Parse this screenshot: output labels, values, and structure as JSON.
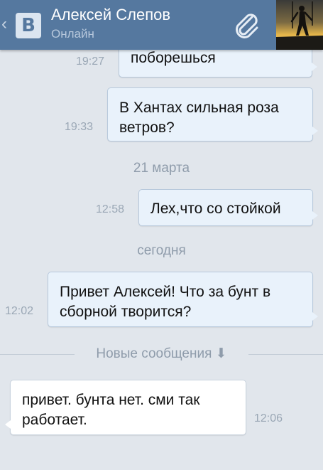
{
  "header": {
    "back_glyph": "‹",
    "logo_letter": "В",
    "contact_name": "Алексей Слепов",
    "status": "Онлайн",
    "attach_icon": "paperclip-icon",
    "avatar_icon": "skier-silhouette-avatar"
  },
  "colors": {
    "header_bg": "#55789f",
    "page_bg": "#e1e6ec",
    "outgoing_bubble": "#e9f2fb",
    "incoming_bubble": "#ffffff"
  },
  "messages": [
    {
      "text": "поборешься",
      "time": "19:27",
      "direction": "outgoing"
    },
    {
      "text": "В Хантах сильная роза ветров?",
      "time": "19:33",
      "direction": "outgoing"
    },
    {
      "text": "Лех,что со стойкой",
      "time": "12:58",
      "direction": "outgoing"
    },
    {
      "text": "Привет Алексей! Что за бунт в сборной творится?",
      "time": "12:02",
      "direction": "outgoing"
    },
    {
      "text": "привет. бунта нет. сми так работает.",
      "time": "12:06",
      "direction": "incoming"
    }
  ],
  "separators": {
    "date_1": "21 марта",
    "date_2": "сегодня",
    "new_messages": "Новые сообщения ⬇"
  }
}
